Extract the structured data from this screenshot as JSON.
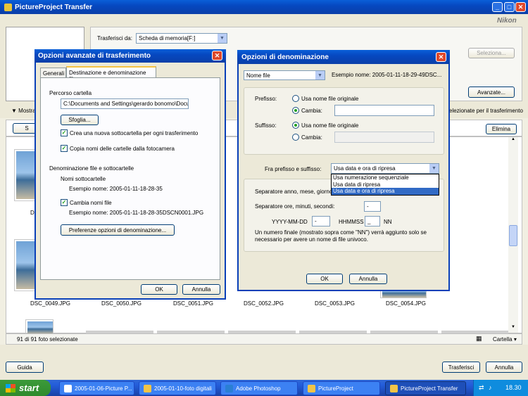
{
  "app": {
    "title": "PictureProject Transfer",
    "brand": "Nikon"
  },
  "top": {
    "transfer_from_label": "Trasferisci da:",
    "source": "Scheda di memoria[F:]",
    "select_btn": "Seleziona...",
    "advanced_btn": "Avanzate..."
  },
  "middle": {
    "show_label": "Mostra",
    "selected_label": "selezionate per il trasferimento",
    "delete_btn": "Elimina"
  },
  "thumbs": {
    "row2": [
      "DSC_0049.JPG",
      "DSC_0050.JPG",
      "DSC_0051.JPG",
      "DSC_0052.JPG",
      "DSC_0053.JPG",
      "DSC_0054.JPG"
    ],
    "row1_partial": "D"
  },
  "status": {
    "count": "91 di 91 foto selezionate",
    "view": "Cartella"
  },
  "bottom": {
    "help_btn": "Guida",
    "transfer_btn": "Trasferisci",
    "cancel_btn": "Annulla"
  },
  "adv": {
    "title": "Opzioni avanzate di trasferimento",
    "tabs": [
      "Generali",
      "Destinazione e denominazione file"
    ],
    "folder_path_label": "Percorso cartella",
    "folder_path": "C:\\Documents and Settings\\gerardo bonomo\\Docu",
    "browse_btn": "Sfoglia...",
    "create_subfolder": "Crea una nuova sottocartella per ogni trasferimento",
    "copy_folder_names": "Copia nomi delle cartelle dalla fotocamera",
    "naming_label": "Denominazione file e sottocartelle",
    "subfolder_names": "Nomi sottocartelle",
    "example1": "Esempio nome: 2005-01-11-18-28-35",
    "change_names": "Cambia nomi file",
    "example2": "Esempio nome: 2005-01-11-18-28-35DSCN0001.JPG",
    "prefs_btn": "Preferenze opzioni di denominazione...",
    "ok": "OK",
    "cancel": "Annulla"
  },
  "naming": {
    "title": "Opzioni di denominazione",
    "type": "Nome file",
    "example": "Esempio nome: 2005-01-11-18-29-49DSC...",
    "prefix_label": "Prefisso:",
    "use_original": "Usa nome file originale",
    "change": "Cambia:",
    "suffix_label": "Suffisso:",
    "between_label": "Fra prefisso e suffisso:",
    "between_value": "Usa data e ora di ripresa",
    "options": [
      "Usa numerazione sequenziale",
      "Usa data di ripresa",
      "Usa data e ora di ripresa"
    ],
    "sep_date_label": "Separatore anno, mese, giorno",
    "sep_time_label": "Separatore ore, minuti, secondi:",
    "sep_time_value": "-",
    "date_fmt": "YYYY-MM-DD",
    "date_sep": "-",
    "time_fmt": "HHMMSS",
    "time_sep": "_",
    "nn": "NN",
    "note": "Un numero finale (mostrato sopra come \"NN\") verrà aggiunto solo se necessario per avere un nome di file univoco.",
    "ok": "OK",
    "cancel": "Annulla"
  },
  "taskbar": {
    "start": "start",
    "items": [
      "2005-01-06-Picture P...",
      "2005-01-10-foto digitali",
      "Adobe Photoshop",
      "PictureProject",
      "PictureProject Transfer"
    ],
    "clock": "18.30"
  }
}
